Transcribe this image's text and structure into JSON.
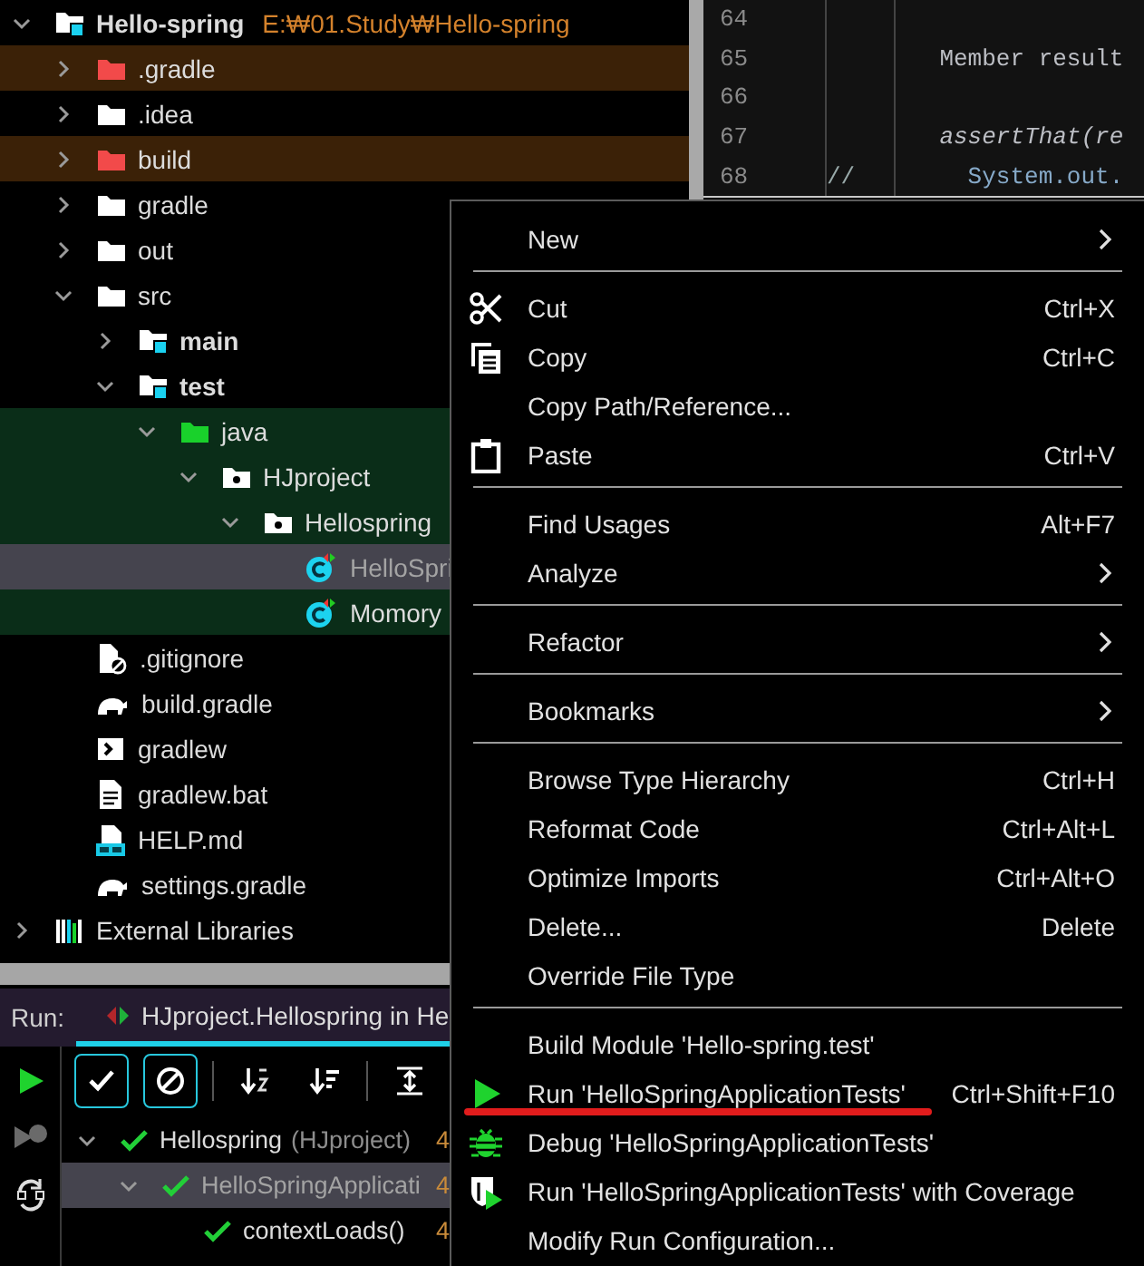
{
  "project_tree": {
    "items": [
      {
        "kind": "module",
        "label": "Hello-spring",
        "path": "E:₩01.Study₩Hello-spring",
        "expanded": true,
        "excluded": false,
        "test_scope": false,
        "selected": false,
        "children": [
          {
            "kind": "excluded-folder",
            "label": ".gradle",
            "expanded": false,
            "excluded": true,
            "test_scope": false,
            "selected": false
          },
          {
            "kind": "folder",
            "label": ".idea",
            "expanded": false,
            "excluded": false,
            "test_scope": false,
            "selected": false
          },
          {
            "kind": "excluded-folder",
            "label": "build",
            "expanded": false,
            "excluded": true,
            "test_scope": false,
            "selected": false
          },
          {
            "kind": "folder",
            "label": "gradle",
            "expanded": false,
            "excluded": false,
            "test_scope": false,
            "selected": false
          },
          {
            "kind": "folder",
            "label": "out",
            "expanded": false,
            "excluded": false,
            "test_scope": false,
            "selected": false
          },
          {
            "kind": "folder",
            "label": "src",
            "expanded": true,
            "excluded": false,
            "test_scope": false,
            "selected": false,
            "children": [
              {
                "kind": "module-folder",
                "label": "main",
                "expanded": false,
                "excluded": false,
                "test_scope": false,
                "selected": false
              },
              {
                "kind": "module-folder",
                "label": "test",
                "expanded": true,
                "excluded": false,
                "test_scope": false,
                "selected": false,
                "children": [
                  {
                    "kind": "test-root",
                    "label": "java",
                    "expanded": true,
                    "excluded": false,
                    "test_scope": true,
                    "selected": false,
                    "children": [
                      {
                        "kind": "package",
                        "label": "HJproject",
                        "expanded": true,
                        "excluded": false,
                        "test_scope": true,
                        "selected": false,
                        "children": [
                          {
                            "kind": "package",
                            "label": "Hellospring",
                            "expanded": true,
                            "excluded": false,
                            "test_scope": true,
                            "selected": false,
                            "children": [
                              {
                                "kind": "test-class",
                                "label": "HelloSpri",
                                "excluded": false,
                                "test_scope": true,
                                "selected": true
                              },
                              {
                                "kind": "test-class",
                                "label": "Momory",
                                "excluded": false,
                                "test_scope": true,
                                "selected": false
                              }
                            ]
                          }
                        ]
                      }
                    ]
                  }
                ]
              }
            ]
          },
          {
            "kind": "ignore-file",
            "label": ".gitignore",
            "excluded": false,
            "test_scope": false,
            "selected": false
          },
          {
            "kind": "gradle-file",
            "label": "build.gradle",
            "excluded": false,
            "test_scope": false,
            "selected": false
          },
          {
            "kind": "script-file",
            "label": "gradlew",
            "excluded": false,
            "test_scope": false,
            "selected": false
          },
          {
            "kind": "text-file",
            "label": "gradlew.bat",
            "excluded": false,
            "test_scope": false,
            "selected": false
          },
          {
            "kind": "markdown-file",
            "label": "HELP.md",
            "excluded": false,
            "test_scope": false,
            "selected": false
          },
          {
            "kind": "gradle-file",
            "label": "settings.gradle",
            "excluded": false,
            "test_scope": false,
            "selected": false
          }
        ]
      },
      {
        "kind": "libraries",
        "label": "External Libraries",
        "expanded": false,
        "excluded": false,
        "test_scope": false,
        "selected": false
      }
    ]
  },
  "editor": {
    "lines": [
      {
        "number": "64"
      },
      {
        "number": "65",
        "code": "    Member result",
        "kind": "plain"
      },
      {
        "number": "66"
      },
      {
        "number": "67",
        "code": "    assertThat(re",
        "kind": "call"
      },
      {
        "number": "68",
        "marker": "//",
        "code": "      System.out.",
        "kind": "comment"
      }
    ]
  },
  "run_panel": {
    "label": "Run:",
    "tab": "HJproject.Hellospring in He",
    "side_tools": [
      {
        "kind": "run"
      },
      {
        "kind": "rerun-failed"
      },
      {
        "kind": "toggle-auto"
      }
    ],
    "toolbar": [
      {
        "kind": "show-passed",
        "on": true
      },
      {
        "kind": "show-ignored",
        "on": true
      },
      {
        "kind": "sort-alpha",
        "on": false
      },
      {
        "kind": "sort-duration",
        "on": false
      },
      {
        "kind": "expand-all",
        "on": false
      }
    ],
    "tests": [
      {
        "label": "Hellospring",
        "detail": "(HJproject)",
        "time": "4",
        "passed": true,
        "expanded": true,
        "selected": false,
        "children": [
          {
            "label": "HelloSpringApplicati",
            "time": "4",
            "passed": true,
            "expanded": true,
            "selected": true,
            "children": [
              {
                "label": "contextLoads()",
                "time": "4",
                "passed": true,
                "selected": false
              }
            ]
          }
        ]
      }
    ]
  },
  "context_menu": {
    "items": [
      {
        "kind": "plain",
        "label": "New",
        "submenu": true,
        "marked": false
      },
      {
        "kind": "separator"
      },
      {
        "kind": "cut",
        "label": "Cut",
        "shortcut": "Ctrl+X",
        "submenu": false,
        "marked": false
      },
      {
        "kind": "copy",
        "label": "Copy",
        "shortcut": "Ctrl+C",
        "submenu": false,
        "marked": false
      },
      {
        "kind": "plain",
        "label": "Copy Path/Reference...",
        "submenu": false,
        "marked": false
      },
      {
        "kind": "paste",
        "label": "Paste",
        "shortcut": "Ctrl+V",
        "submenu": false,
        "marked": false
      },
      {
        "kind": "separator"
      },
      {
        "kind": "plain",
        "label": "Find Usages",
        "shortcut": "Alt+F7",
        "submenu": false,
        "marked": false
      },
      {
        "kind": "plain",
        "label": "Analyze",
        "submenu": true,
        "marked": false
      },
      {
        "kind": "separator"
      },
      {
        "kind": "plain",
        "label": "Refactor",
        "submenu": true,
        "marked": false
      },
      {
        "kind": "separator"
      },
      {
        "kind": "plain",
        "label": "Bookmarks",
        "submenu": true,
        "marked": false
      },
      {
        "kind": "separator"
      },
      {
        "kind": "plain",
        "label": "Browse Type Hierarchy",
        "shortcut": "Ctrl+H",
        "submenu": false,
        "marked": false
      },
      {
        "kind": "plain",
        "label": "Reformat Code",
        "shortcut": "Ctrl+Alt+L",
        "submenu": false,
        "marked": false
      },
      {
        "kind": "plain",
        "label": "Optimize Imports",
        "shortcut": "Ctrl+Alt+O",
        "submenu": false,
        "marked": false
      },
      {
        "kind": "plain",
        "label": "Delete...",
        "shortcut": "Delete",
        "submenu": false,
        "marked": false
      },
      {
        "kind": "plain",
        "label": "Override File Type",
        "submenu": false,
        "marked": false
      },
      {
        "kind": "separator"
      },
      {
        "kind": "plain",
        "label": "Build Module 'Hello-spring.test'",
        "submenu": false,
        "marked": false
      },
      {
        "kind": "run",
        "label": "Run 'HelloSpringApplicationTests'",
        "shortcut": "Ctrl+Shift+F10",
        "submenu": false,
        "marked": true
      },
      {
        "kind": "debug",
        "label": "Debug 'HelloSpringApplicationTests'",
        "submenu": false,
        "marked": false
      },
      {
        "kind": "coverage",
        "label": "Run 'HelloSpringApplicationTests' with Coverage",
        "submenu": false,
        "marked": false
      },
      {
        "kind": "plain",
        "label": "Modify Run Configuration...",
        "submenu": false,
        "marked": false
      }
    ]
  }
}
